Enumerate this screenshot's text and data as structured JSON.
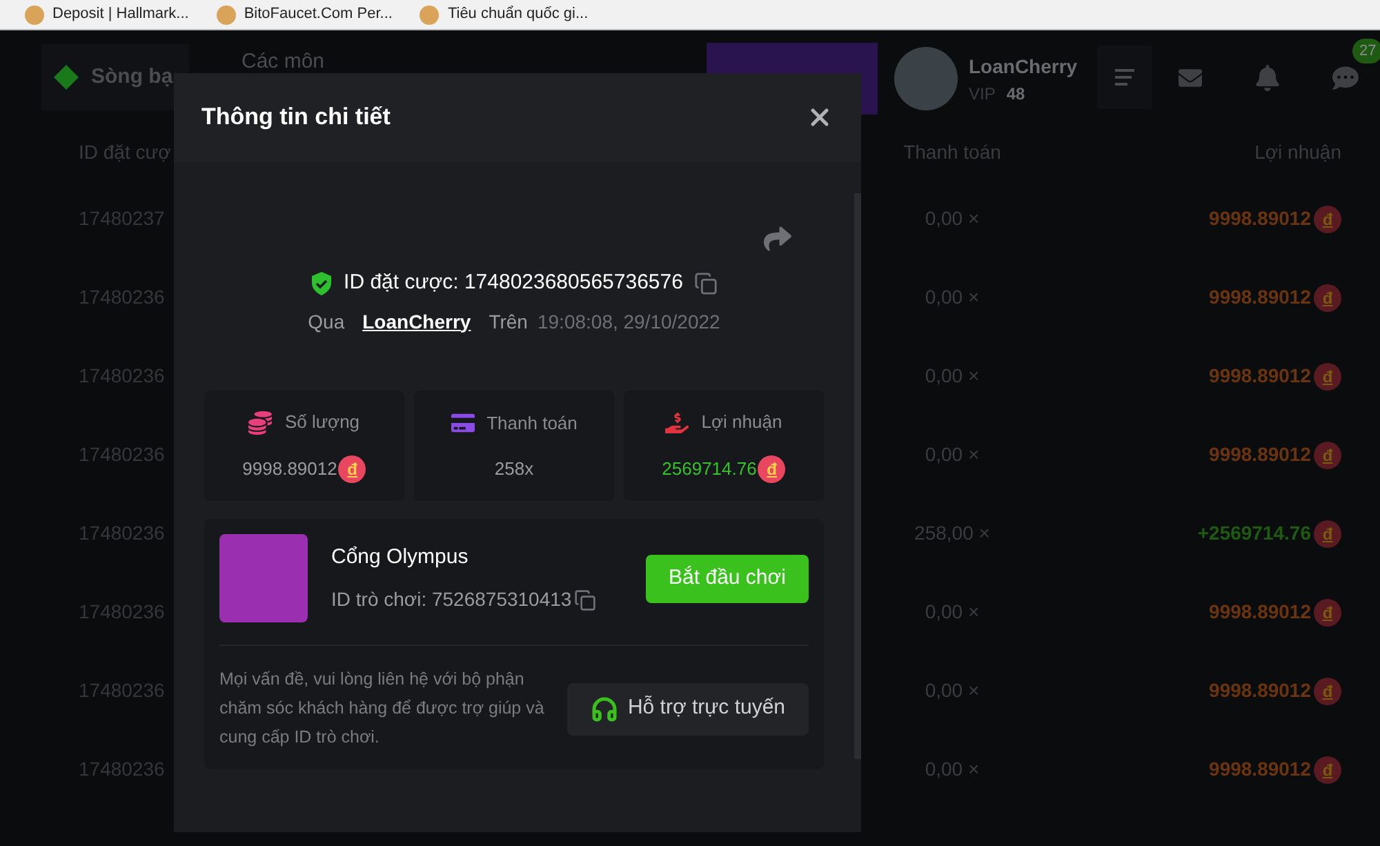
{
  "bookmarks": [
    {
      "label": "Deposit | Hallmark..."
    },
    {
      "label": "BitoFaucet.Com Per..."
    },
    {
      "label": "Tiêu chuẩn quốc gi..."
    }
  ],
  "header": {
    "brand": "Sòng bạ",
    "nav": "Các môn",
    "user": {
      "name": "LoanCherry",
      "vip_label": "VIP",
      "vip_level": "48"
    },
    "chat_badge": "27"
  },
  "table": {
    "columns": [
      "ID đặt cượ",
      "Thanh toán",
      "Lợi nhuận"
    ],
    "rows": [
      {
        "id": "17480237",
        "payout": "0,00 ×",
        "profit": "9998.89012",
        "currency": "đ",
        "kind": "loss"
      },
      {
        "id": "17480236",
        "payout": "0,00 ×",
        "profit": "9998.89012",
        "currency": "đ",
        "kind": "loss"
      },
      {
        "id": "17480236",
        "payout": "0,00 ×",
        "profit": "9998.89012",
        "currency": "đ",
        "kind": "loss"
      },
      {
        "id": "17480236",
        "payout": "0,00 ×",
        "profit": "9998.89012",
        "currency": "đ",
        "kind": "loss"
      },
      {
        "id": "17480236",
        "payout": "258,00 ×",
        "profit": "+2569714.76",
        "currency": "đ",
        "kind": "win"
      },
      {
        "id": "17480236",
        "payout": "0,00 ×",
        "profit": "9998.89012",
        "currency": "đ",
        "kind": "loss"
      },
      {
        "id": "17480236",
        "payout": "0,00 ×",
        "profit": "9998.89012",
        "currency": "đ",
        "kind": "loss"
      },
      {
        "id": "17480236",
        "payout": "0,00 ×",
        "profit": "9998.89012",
        "currency": "đ",
        "kind": "loss"
      }
    ]
  },
  "modal": {
    "title": "Thông tin chi tiết",
    "bet_id": "ID đặt cược: 1748023680565736576",
    "by_label": "Qua",
    "user": "LoanCherry",
    "on_label": "Trên",
    "time": "19:08:08, 29/10/2022",
    "stats": [
      {
        "kind": "amount",
        "label": "Số lượng",
        "value": "9998.89012",
        "currency": "đ"
      },
      {
        "kind": "payout",
        "label": "Thanh toán",
        "value": "258x"
      },
      {
        "kind": "profit",
        "label": "Lợi nhuận",
        "value": "2569714.76",
        "currency": "đ"
      }
    ],
    "game": {
      "title": "Cổng Olympus",
      "id_text": "ID trò chơi: 7526875310413",
      "play_button": "Bắt đầu chơi",
      "support_text": "Mọi vấn đề, vui lòng liên hệ với bộ phận chăm sóc khách hàng để được trợ giúp và cung cấp ID trò chơi.",
      "support_button": "Hỗ trợ trực tuyến"
    }
  }
}
